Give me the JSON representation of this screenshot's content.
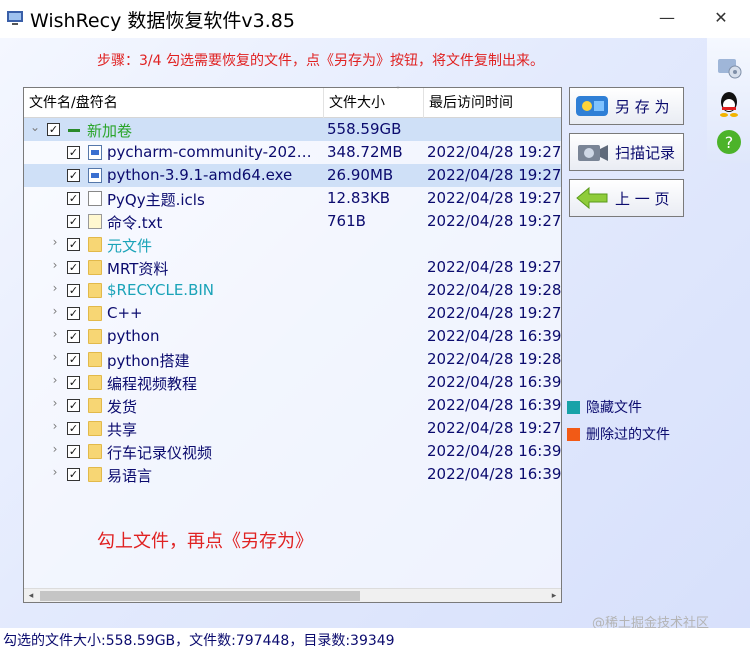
{
  "window": {
    "title": "WishRecy 数据恢复软件v3.85",
    "minimize_glyph": "—",
    "close_glyph": "✕"
  },
  "step_text": "步骤：3/4 勾选需要恢复的文件，点《另存为》按钮，将文件复制出来。",
  "columns": [
    "文件名/盘符名",
    "文件大小",
    "最后访问时间"
  ],
  "rows": [
    {
      "name": "新加卷",
      "size": "558.59GB",
      "date": "",
      "icon": "drive-icon",
      "expander": "⌄",
      "color": "green",
      "level": 0,
      "selected": true
    },
    {
      "name": "pycharm-community-202…",
      "size": "348.72MB",
      "date": "2022/04/28 19:27:",
      "icon": "exe-icon",
      "expander": "",
      "color": "",
      "level": 1,
      "selected": false
    },
    {
      "name": "python-3.9.1-amd64.exe",
      "size": "26.90MB",
      "date": "2022/04/28 19:27:",
      "icon": "exe-icon",
      "expander": "",
      "color": "",
      "level": 1,
      "selected": true
    },
    {
      "name": "PyQy主题.icls",
      "size": "12.83KB",
      "date": "2022/04/28 19:27:",
      "icon": "file-icon",
      "expander": "",
      "color": "",
      "level": 1,
      "selected": false
    },
    {
      "name": "命令.txt",
      "size": "761B",
      "date": "2022/04/28 19:27:",
      "icon": "txt-icon",
      "expander": "",
      "color": "",
      "level": 1,
      "selected": false
    },
    {
      "name": "元文件",
      "size": "",
      "date": "",
      "icon": "folder-icon",
      "expander": "›",
      "color": "teal",
      "level": 1,
      "selected": false
    },
    {
      "name": "MRT资料",
      "size": "",
      "date": "2022/04/28 19:27:",
      "icon": "folder-icon",
      "expander": "›",
      "color": "",
      "level": 1,
      "selected": false
    },
    {
      "name": "$RECYCLE.BIN",
      "size": "",
      "date": "2022/04/28 19:28:",
      "icon": "folder-icon",
      "expander": "›",
      "color": "teal",
      "level": 1,
      "selected": false
    },
    {
      "name": "C++",
      "size": "",
      "date": "2022/04/28 19:27:",
      "icon": "folder-icon",
      "expander": "›",
      "color": "",
      "level": 1,
      "selected": false
    },
    {
      "name": "python",
      "size": "",
      "date": "2022/04/28 16:39:",
      "icon": "folder-icon",
      "expander": "›",
      "color": "",
      "level": 1,
      "selected": false
    },
    {
      "name": "python搭建",
      "size": "",
      "date": "2022/04/28 19:28:",
      "icon": "folder-icon",
      "expander": "›",
      "color": "",
      "level": 1,
      "selected": false
    },
    {
      "name": "编程视频教程",
      "size": "",
      "date": "2022/04/28 16:39:",
      "icon": "folder-icon",
      "expander": "›",
      "color": "",
      "level": 1,
      "selected": false
    },
    {
      "name": "发货",
      "size": "",
      "date": "2022/04/28 16:39:",
      "icon": "folder-icon",
      "expander": "›",
      "color": "",
      "level": 1,
      "selected": false
    },
    {
      "name": "共享",
      "size": "",
      "date": "2022/04/28 19:27:",
      "icon": "folder-icon",
      "expander": "›",
      "color": "",
      "level": 1,
      "selected": false
    },
    {
      "name": "行车记录仪视频",
      "size": "",
      "date": "2022/04/28 16:39:",
      "icon": "folder-icon",
      "expander": "›",
      "color": "",
      "level": 1,
      "selected": false
    },
    {
      "name": "易语言",
      "size": "",
      "date": "2022/04/28 16:39:",
      "icon": "folder-icon",
      "expander": "›",
      "color": "",
      "level": 1,
      "selected": false
    }
  ],
  "hint": "勾上文件，再点《另存为》",
  "buttons": {
    "save_as": "另 存 为",
    "scan_record": "扫描记录",
    "prev_page": "上 一 页"
  },
  "legend": {
    "hidden": {
      "label": "隐藏文件",
      "color": "#17a2a8"
    },
    "deleted": {
      "label": "删除过的文件",
      "color": "#f25a16"
    }
  },
  "status": "勾选的文件大小:558.59GB，文件数:797448，目录数:39349",
  "watermark": "@稀土掘金技术社区",
  "colors": {
    "accent_red": "#e02222",
    "text_navy": "#0b0b6e",
    "green": "#2aa52a",
    "teal": "#1aa3b8"
  },
  "sidebar_icons": [
    "settings-icon",
    "qq-icon",
    "help-icon"
  ]
}
